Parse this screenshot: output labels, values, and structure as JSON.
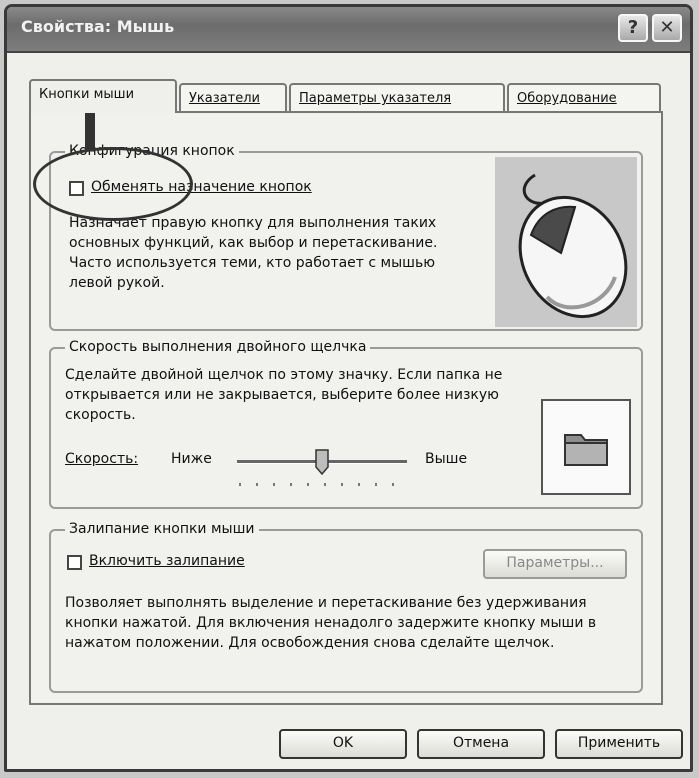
{
  "window": {
    "title": "Свойства: Мышь",
    "help_icon": "?",
    "close_icon": "✕"
  },
  "tabs": [
    {
      "label": "Кнопки мыши",
      "active": true
    },
    {
      "label": "Указатели",
      "active": false
    },
    {
      "label": "Параметры указателя",
      "active": false
    },
    {
      "label": "Оборудование",
      "active": false
    }
  ],
  "buttons_config": {
    "legend": "Конфигурация кнопок",
    "swap_label": "Обменять назначение кнопок",
    "swap_checked": false,
    "description": "Назначает правую кнопку для выполнения таких основных функций, как выбор и перетаскивание. Часто используется теми, кто работает с мышью левой рукой."
  },
  "double_click": {
    "legend": "Скорость выполнения двойного щелчка",
    "description": "Сделайте двойной щелчок по этому значку. Если папка не открывается или не закрывается, выберите более низкую скорость.",
    "speed_label": "Скорость:",
    "low_label": "Ниже",
    "high_label": "Выше",
    "speed_value": 0.5
  },
  "click_lock": {
    "legend": "Залипание кнопки мыши",
    "enable_label": "Включить залипание",
    "enable_checked": false,
    "settings_button": "Параметры...",
    "description": "Позволяет выполнять выделение и перетаскивание без удерживания кнопки нажатой. Для включения ненадолго задержите кнопку мыши в нажатом положении. Для освобождения снова сделайте щелчок."
  },
  "footer": {
    "ok": "OK",
    "cancel": "Отмена",
    "apply": "Применить"
  }
}
